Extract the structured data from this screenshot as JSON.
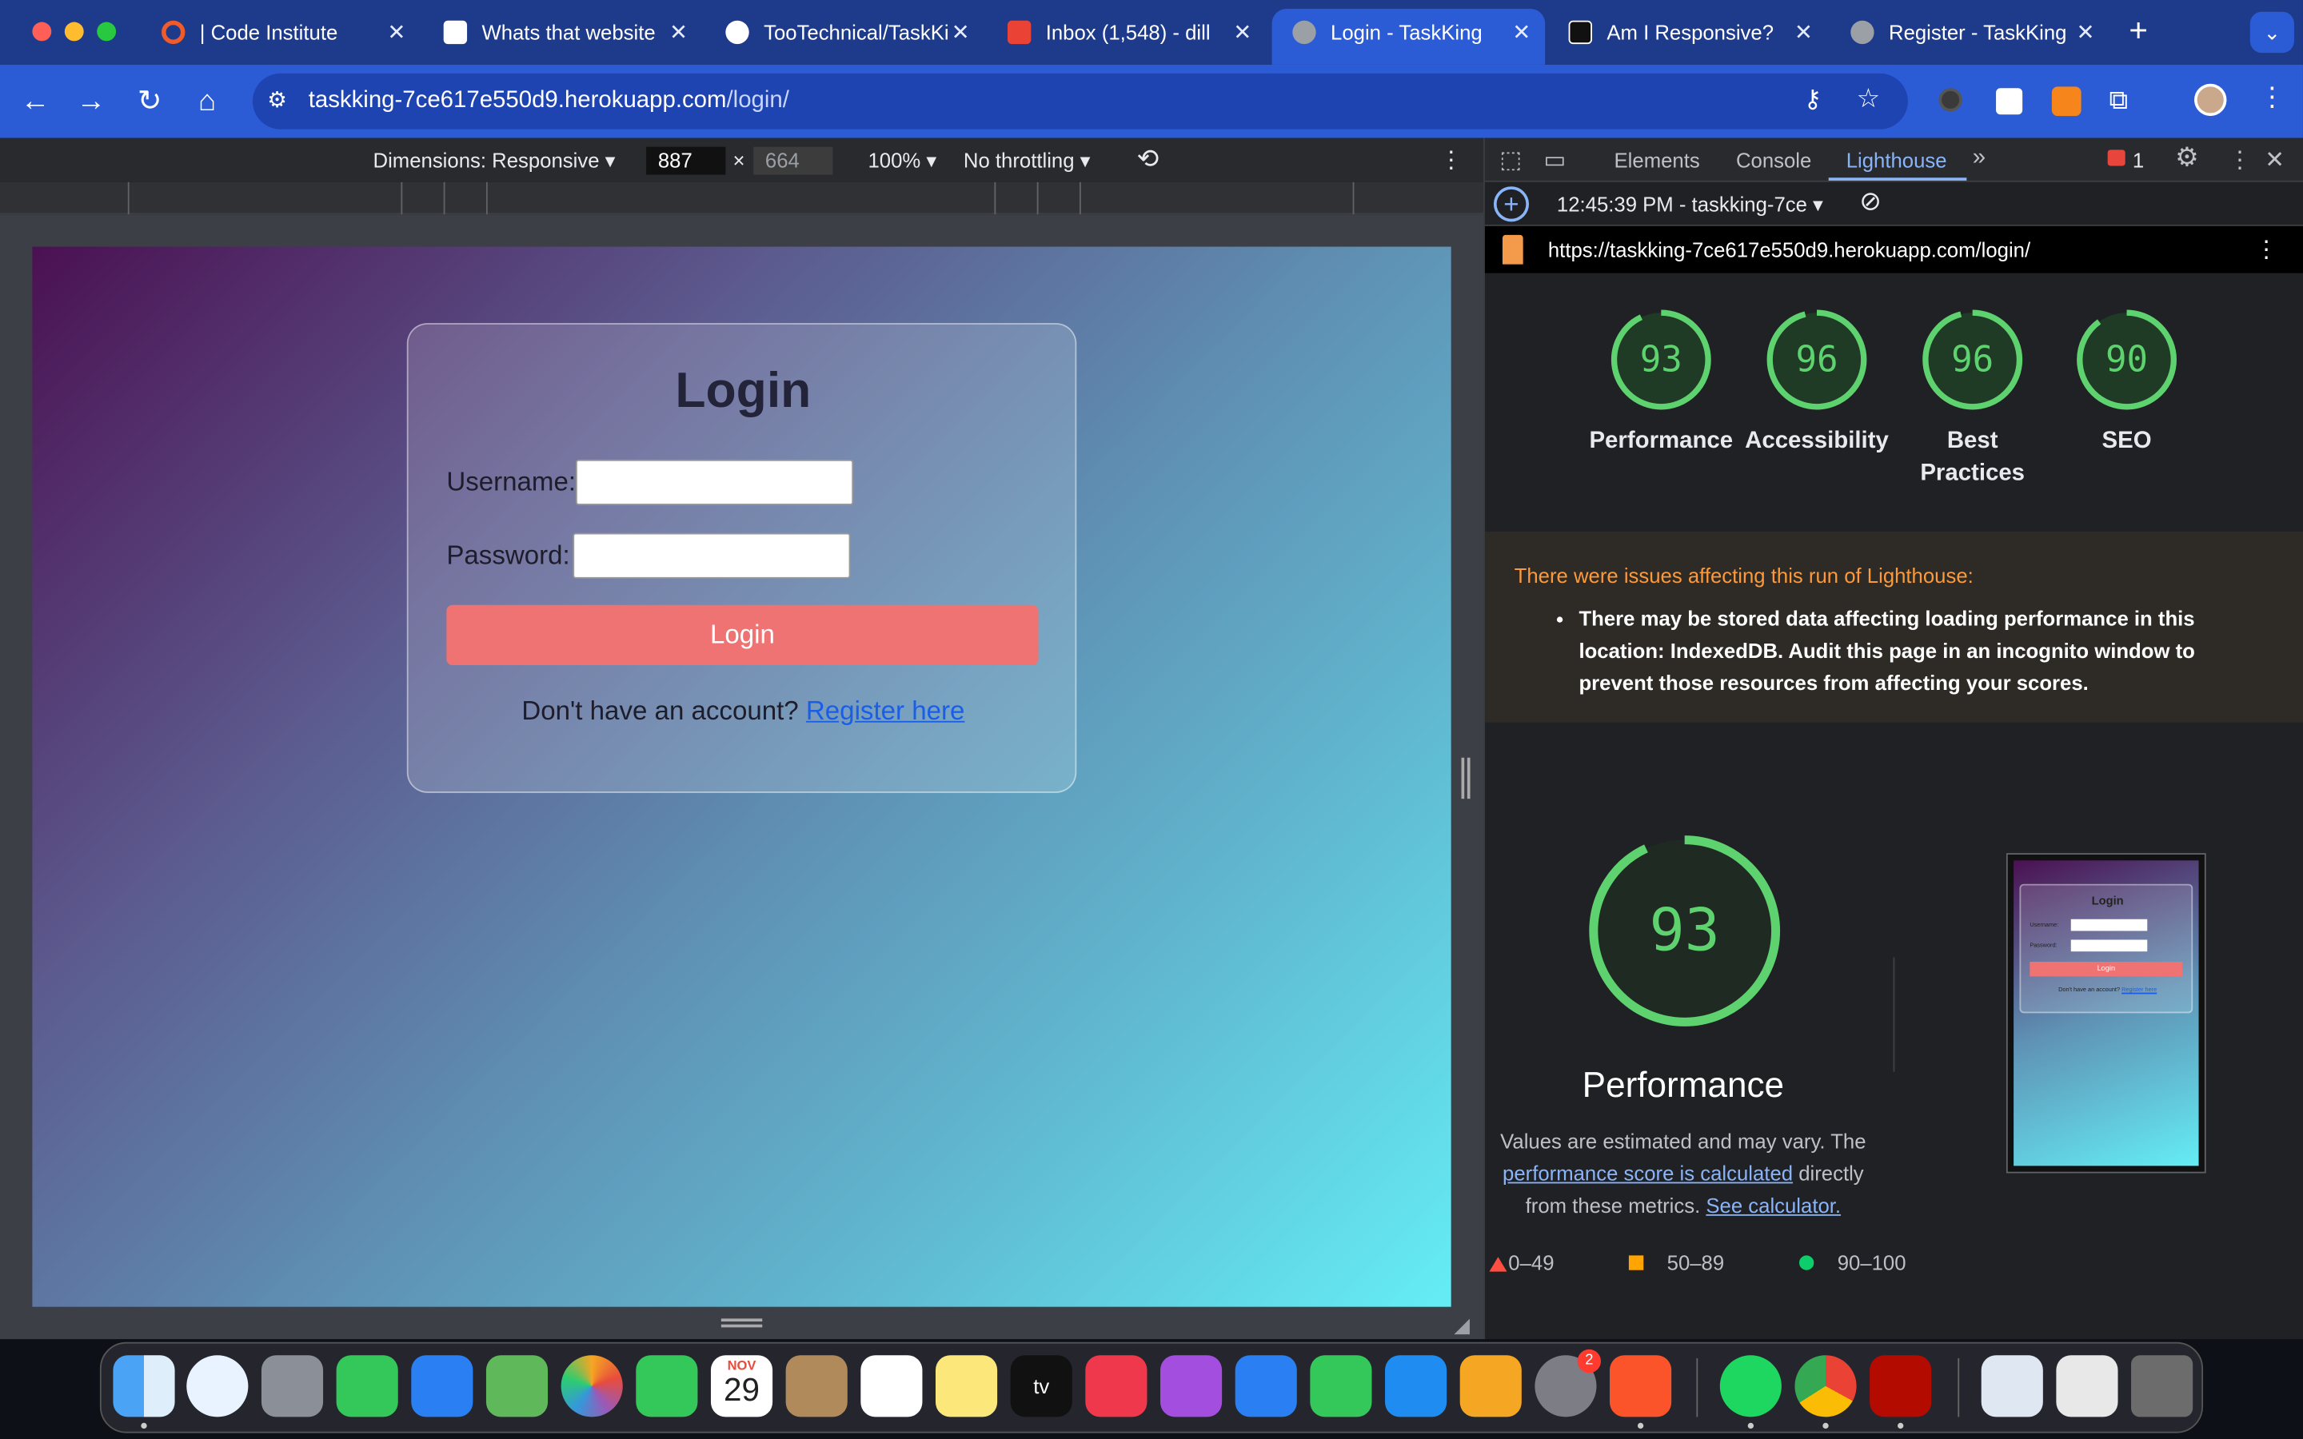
{
  "browser": {
    "tabs": [
      {
        "title": "| Code Institute",
        "color": "#ef5b2b",
        "active": false
      },
      {
        "title": "Whats that website",
        "color": "#fff",
        "active": false
      },
      {
        "title": "TooTechnical/TaskKing",
        "color": "#fff",
        "active": false
      },
      {
        "title": "Inbox (1,548) - dill",
        "color": "#ea4335",
        "active": false
      },
      {
        "title": "Login - TaskKing",
        "color": "#9aa0a6",
        "active": true
      },
      {
        "title": "Am I Responsive?",
        "color": "#fff",
        "active": false
      },
      {
        "title": "Register - TaskKing",
        "color": "#9aa0a6",
        "active": false
      }
    ],
    "new_tab": "+",
    "url_host": "taskking-7ce617e550d9.herokuapp.com",
    "url_path": "/login/"
  },
  "device_toolbar": {
    "dimensions": "Dimensions: Responsive",
    "width": "887",
    "times": "×",
    "height": "664",
    "zoom": "100%",
    "throttling": "No throttling"
  },
  "page": {
    "title": "Login",
    "username_label": "Username:",
    "password_label": "Password:",
    "login_button": "Login",
    "register_prompt": "Don't have an account?",
    "register_link": "Register here"
  },
  "devtools": {
    "tabs": [
      "Elements",
      "Console",
      "Lighthouse"
    ],
    "active_tab": "Lighthouse",
    "more_tabs": "»",
    "issues_count": "1",
    "report_time": "12:45:39 PM - taskking-7ce",
    "report_url": "https://taskking-7ce617e550d9.herokuapp.com/login/",
    "scores": [
      {
        "label": "Performance",
        "value": 93
      },
      {
        "label": "Accessibility",
        "value": 96
      },
      {
        "label": "Best Practices",
        "value": 96
      },
      {
        "label": "SEO",
        "value": 90
      }
    ],
    "warning_head": "There were issues affecting this run of Lighthouse:",
    "warning_item": "There may be stored data affecting loading performance in this location: IndexedDB. Audit this page in an incognito window to prevent those resources from affecting your scores.",
    "perf_score": 93,
    "perf_title": "Performance",
    "perf_desc_1": "Values are estimated and may vary. The",
    "perf_link": "performance score is calculated",
    "perf_desc_2": "directly from these metrics.",
    "calc_link": "See calculator.",
    "legend": [
      "0–49",
      "50–89",
      "90–100"
    ],
    "legend_colors": [
      "#ff4e42",
      "#ffa400",
      "#0cce6b"
    ],
    "thumb": {
      "title": "Login",
      "username": "Username:",
      "password": "Password:",
      "button": "Login",
      "prompt": "Don't have an account?",
      "link": "Register here"
    }
  },
  "dock": {
    "calendar_month": "NOV",
    "calendar_day": "29",
    "settings_badge": "2",
    "tv_label": "tv"
  }
}
